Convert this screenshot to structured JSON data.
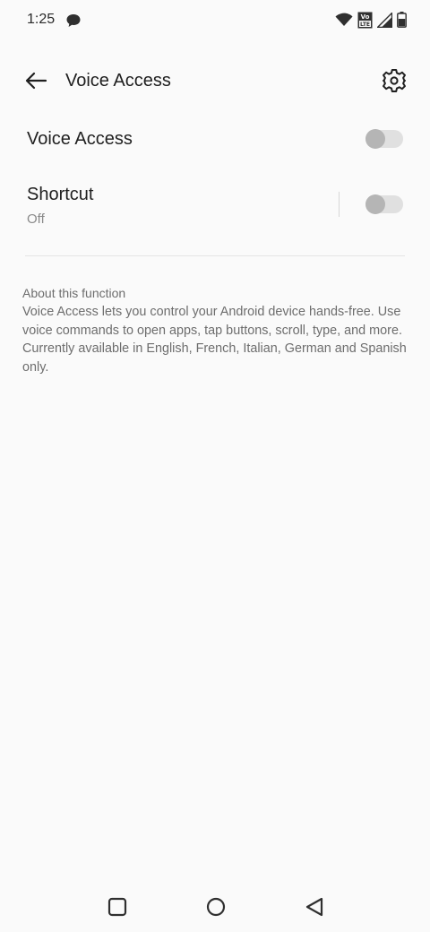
{
  "status_bar": {
    "time": "1:25",
    "icons": [
      "chat-bubble-icon",
      "wifi-icon",
      "volte-icon",
      "signal-icon",
      "battery-icon"
    ],
    "volte_label": [
      "Vo",
      "LTE"
    ]
  },
  "app_bar": {
    "title": "Voice Access",
    "back_icon": "arrow-left-icon",
    "settings_icon": "gear-icon"
  },
  "settings": {
    "voice_access": {
      "label": "Voice Access",
      "enabled": false
    },
    "shortcut": {
      "label": "Shortcut",
      "status": "Off",
      "enabled": false
    }
  },
  "about": {
    "heading": "About this function",
    "body": "Voice Access lets you control your Android device hands-free. Use voice commands to open apps, tap buttons, scroll, type, and more. Currently available in English, French, Italian, German and Spanish only."
  },
  "navigation": {
    "icons": [
      "recents-square-icon",
      "home-circle-icon",
      "back-triangle-icon"
    ]
  },
  "colors": {
    "background": "#fafafa",
    "switch_track": "#e0e0e0",
    "switch_thumb": "#b5b5b5",
    "secondary_text": "#6d6d6d"
  }
}
